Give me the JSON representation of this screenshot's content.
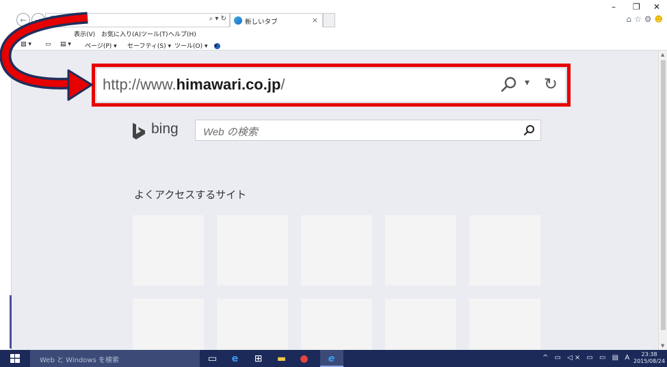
{
  "window": {
    "minimize_glyph": "–",
    "restore_glyph": "❐",
    "close_glyph": "✕"
  },
  "toolbar": {
    "back_glyph": "←",
    "forward_glyph": "→",
    "small_address_tools": "⌕ ▾ ↻",
    "tab_label": "新しいタブ",
    "tab_close": "×",
    "right_icons": [
      "home-icon",
      "favorites-star-icon",
      "settings-gear-icon",
      "smiley-feedback-icon"
    ]
  },
  "menubar": {
    "items": [
      "お気に入り(A)",
      "ツール(T)",
      "ヘルプ(H)"
    ],
    "partial_left": "表示(V)"
  },
  "commandbar": {
    "items": [
      "ページ(P) ▾",
      "セーフティ(S) ▾",
      "ツール(O) ▾",
      "▾"
    ]
  },
  "address": {
    "url_prefix": "http://www.",
    "url_domain": "himawari.co.jp",
    "url_suffix": "/",
    "dropdown_glyph": "▾",
    "refresh_glyph": "↻"
  },
  "bing": {
    "word": "bing",
    "placeholder": "Web の検索"
  },
  "frequent": {
    "title": "よくアクセスするサイト"
  },
  "taskbar": {
    "search_placeholder": "Web と Windows を検索",
    "tray_icons": "^ ▭ ◁× ▭ ▭ ▤ A",
    "time": "23:38",
    "date": "2015/08/24"
  },
  "colors": {
    "highlight_red": "#e60000",
    "arrow_navy": "#1f2f5c",
    "page_bg": "#eaecf1",
    "taskbar_bg": "#1c2a5a"
  }
}
